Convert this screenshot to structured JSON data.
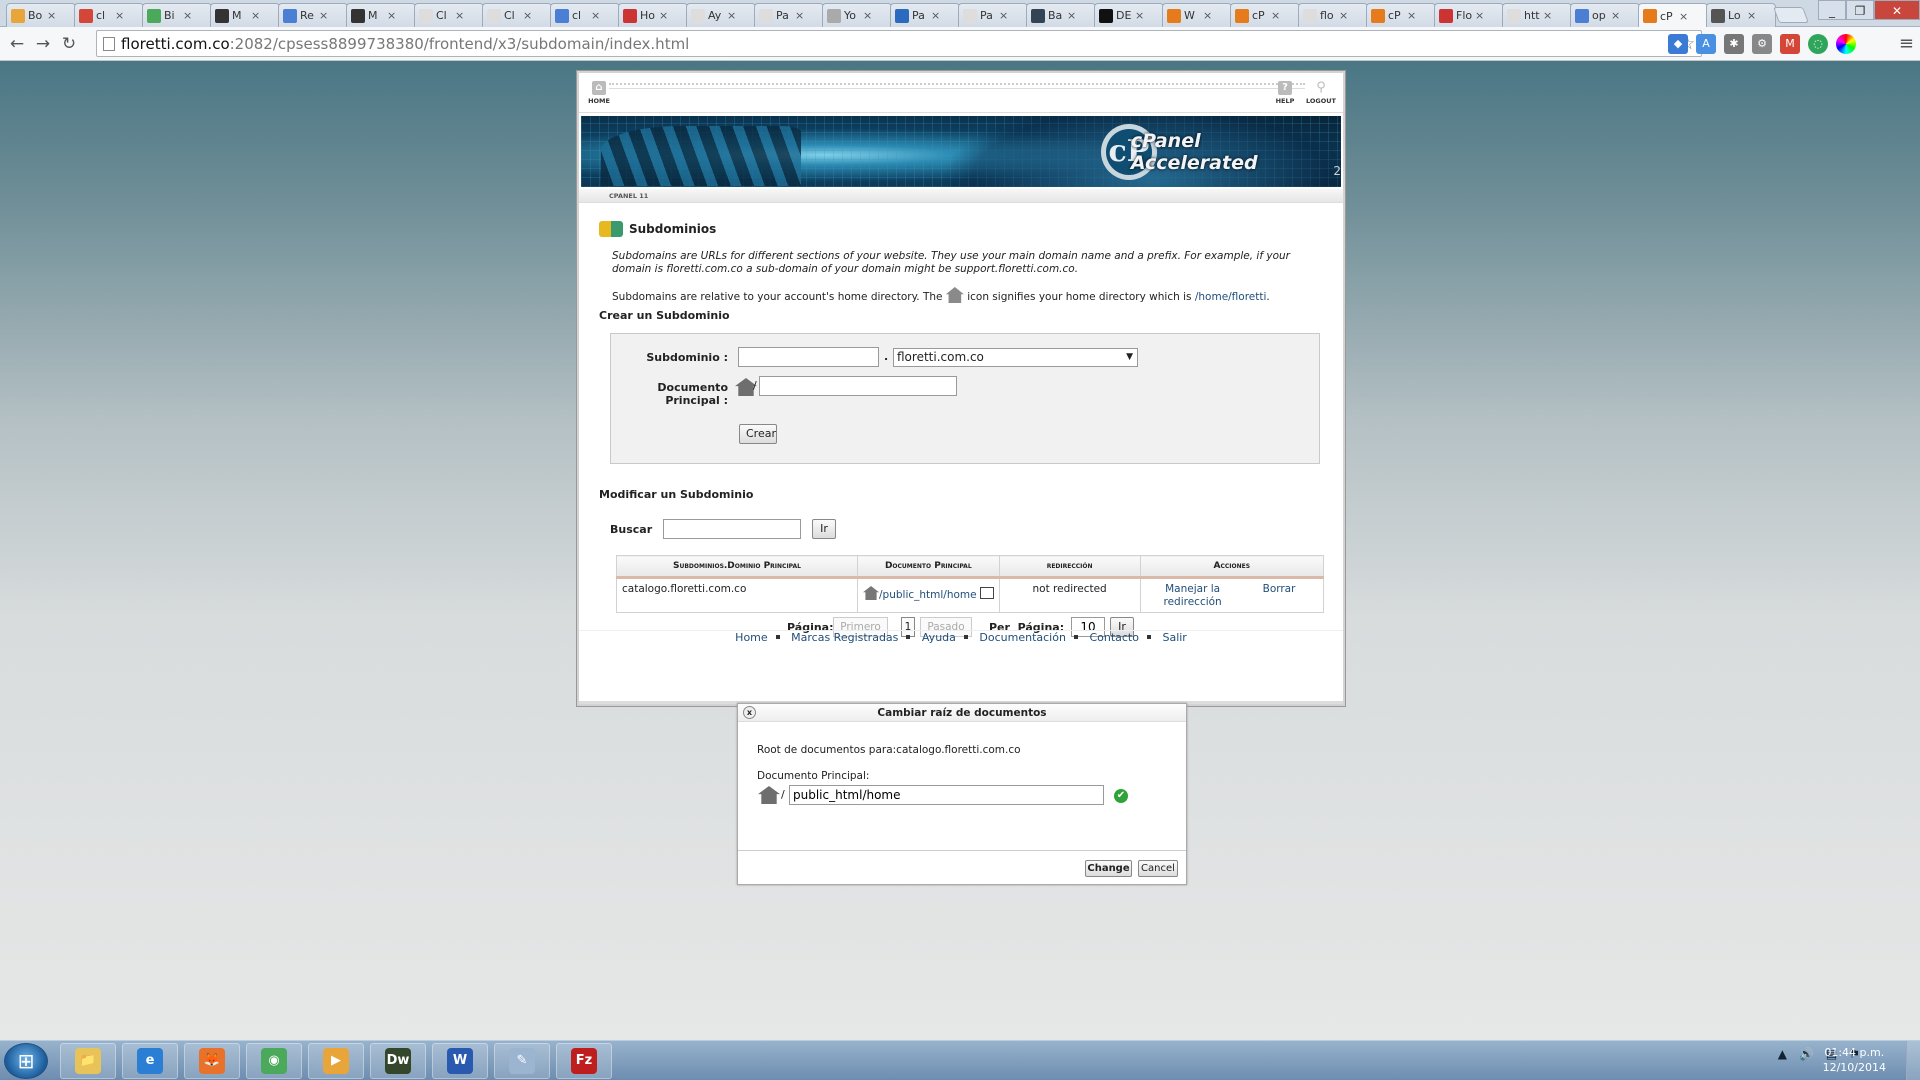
{
  "browser": {
    "tabs": [
      {
        "title": "Bo",
        "fav": "#e8a53a"
      },
      {
        "title": "cl",
        "fav": "#d44638"
      },
      {
        "title": "Bi",
        "fav": "#4aa95a"
      },
      {
        "title": "M",
        "fav": "#333"
      },
      {
        "title": "Re",
        "fav": "#4a7fd4"
      },
      {
        "title": "M",
        "fav": "#333"
      },
      {
        "title": "Cl",
        "fav": "#ddd"
      },
      {
        "title": "Cl",
        "fav": "#ddd"
      },
      {
        "title": "cl",
        "fav": "#4a7fd4"
      },
      {
        "title": "Ho",
        "fav": "#c33"
      },
      {
        "title": "Ay",
        "fav": "#ddd"
      },
      {
        "title": "Pa",
        "fav": "#ddd"
      },
      {
        "title": "Yo",
        "fav": "#aaa"
      },
      {
        "title": "Pa",
        "fav": "#2a6bbf"
      },
      {
        "title": "Pa",
        "fav": "#ddd"
      },
      {
        "title": "Ba",
        "fav": "#345"
      },
      {
        "title": "DE",
        "fav": "#111"
      },
      {
        "title": "W",
        "fav": "#e67b1c"
      },
      {
        "title": "cP",
        "fav": "#e67b1c"
      },
      {
        "title": "flo",
        "fav": "#ddd"
      },
      {
        "title": "cP",
        "fav": "#e67b1c"
      },
      {
        "title": "Flo",
        "fav": "#c33"
      },
      {
        "title": "htt",
        "fav": "#ddd"
      },
      {
        "title": "op",
        "fav": "#4a7fd4"
      },
      {
        "title": "cP",
        "fav": "#e67b1c",
        "active": true
      },
      {
        "title": "Lo",
        "fav": "#555"
      }
    ],
    "close_glyph": "×",
    "url_host": "floretti.com.co",
    "url_rest": ":2082/cpsess8899738380/frontend/x3/subdomain/index.html"
  },
  "cpanel": {
    "nav": {
      "home": "HOME",
      "help": "HELP",
      "logout": "LOGOUT"
    },
    "logo": {
      "letter": "cP",
      "text": "cPanel Accelerated",
      "sub": "2"
    },
    "version_label": "CPANEL 11",
    "page_title": "Subdominios",
    "desc1": "Subdomains are URLs for different sections of your website. They use your main domain name and a prefix. For example, if your domain is floretti.com.co a sub-domain of your domain might be support.floretti.com.co.",
    "desc2_pre": "Subdomains are relative to your account's home directory. The",
    "desc2_post": "icon signifies your home directory which is",
    "home_dir": "/home/floretti",
    "create": {
      "heading": "Crear un Subdominio",
      "subdomain_label": "Subdominio :",
      "dot": ".",
      "domain_selected": "floretti.com.co",
      "docroot_label": "Documento Principal :",
      "slash": "/",
      "create_button": "Crear"
    },
    "modify": {
      "heading": "Modificar un Subdominio",
      "search_label": "Buscar",
      "go_button": "Ir",
      "columns": [
        "Subdominios.Dominio Principal",
        "Documento Principal",
        "redirección",
        "Acciones"
      ],
      "rows": [
        {
          "subdomain": "catalogo.floretti.com.co",
          "docroot": "/public_html/home",
          "redirect": "not redirected",
          "action_manage": "Manejar la redirección",
          "action_delete": "Borrar"
        }
      ]
    },
    "pagination": {
      "page_label": "Página:",
      "first": "Primero",
      "current": "1",
      "last": "Pasado",
      "per_page_label": "Per  Página:",
      "per_page_value": "10",
      "go": "Ir"
    },
    "footer": [
      "Home",
      "Marcas Registradas",
      "Ayuda",
      "Documentación",
      "Contacto",
      "Salir"
    ]
  },
  "dialog": {
    "title": "Cambiar raíz de documentos",
    "close_glyph": "x",
    "root_for": "Root de documentos para:catalogo.floretti.com.co",
    "docroot_label": "Documento Principal:",
    "slash": "/",
    "docroot_value": "public_html/home",
    "check_glyph": "✔",
    "change_button": "Change",
    "cancel_button": "Cancel"
  },
  "taskbar": {
    "apps": [
      {
        "name": "explorer",
        "label": "📁",
        "color": "#e8c35a"
      },
      {
        "name": "ie",
        "label": "e",
        "color": "#2a7fd4"
      },
      {
        "name": "firefox",
        "label": "🦊",
        "color": "#e8722a"
      },
      {
        "name": "chrome",
        "label": "◉",
        "color": "#4aa95a"
      },
      {
        "name": "media",
        "label": "▶",
        "color": "#e8a53a"
      },
      {
        "name": "dreamweaver",
        "label": "Dw",
        "color": "#35472b"
      },
      {
        "name": "word",
        "label": "W",
        "color": "#2a5ab0"
      },
      {
        "name": "notepad",
        "label": "✎",
        "color": "#9bb5d0"
      },
      {
        "name": "filezilla",
        "label": "Fz",
        "color": "#bf1e1e"
      }
    ],
    "time": "01:44 p.m.",
    "date": "12/10/2014"
  },
  "colors": {
    "link": "#1f4e79",
    "header_accent": "#dbb9a8"
  }
}
